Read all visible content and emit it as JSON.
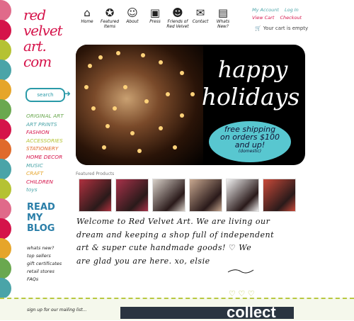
{
  "logo": {
    "lines": [
      "red",
      "velvet",
      "art.",
      "com"
    ]
  },
  "search": {
    "label": "search"
  },
  "categories": [
    {
      "label": "ORIGINAL ART",
      "color": "#6aa84f"
    },
    {
      "label": "ART PRINTS",
      "color": "#4aa4a8"
    },
    {
      "label": "FASHION",
      "color": "#d5134a"
    },
    {
      "label": "ACCESSORIES",
      "color": "#b5c233"
    },
    {
      "label": "STATIONERY",
      "color": "#e06a2a"
    },
    {
      "label": "HOME DECOR",
      "color": "#d5134a"
    },
    {
      "label": "MUSIC",
      "color": "#4aa4a8"
    },
    {
      "label": "CRAFT",
      "color": "#e6a52a"
    },
    {
      "label": "CHILDREN",
      "color": "#d5134a"
    },
    {
      "label": "toys",
      "color": "#4aa4a8"
    }
  ],
  "blog": {
    "lines": [
      "READ",
      "MY",
      "BLOG"
    ]
  },
  "side_links": [
    "whats new?",
    "top sellers",
    "gift certificates",
    "retail stores",
    "FAQs"
  ],
  "nav": [
    {
      "label": "Home",
      "icon": "house-icon",
      "glyph": "⌂"
    },
    {
      "label": "Featured Items",
      "icon": "ribbon-icon",
      "glyph": "✪"
    },
    {
      "label": "About",
      "icon": "girl-icon",
      "glyph": "☺"
    },
    {
      "label": "Press",
      "icon": "tv-icon",
      "glyph": "▣"
    },
    {
      "label": "Friends of Red Velvet",
      "icon": "friend-icon",
      "glyph": "☻"
    },
    {
      "label": "Contact",
      "icon": "envelope-icon",
      "glyph": "✉"
    },
    {
      "label": "Whats New?",
      "icon": "camera-icon",
      "glyph": "▤"
    }
  ],
  "account": {
    "row1": [
      "My Account",
      "Log In"
    ],
    "row2": [
      "View Cart",
      "Checkout"
    ],
    "cart_status": "Your cart is empty"
  },
  "banner": {
    "line1": "happy",
    "line2": "holidays",
    "ship1": "free shipping",
    "ship2": "on orders $100",
    "ship3": "and up!",
    "ship4": "(domestic)"
  },
  "featured_label": "Featured Products",
  "products": [
    {
      "color": "#b0313f"
    },
    {
      "color": "#a8324a"
    },
    {
      "color": "#d8d0c8"
    },
    {
      "color": "#c8a890"
    },
    {
      "color": "#f0f0f0"
    },
    {
      "color": "#c94a3a"
    }
  ],
  "welcome": [
    "Welcome to Red Velvet Art. We are living our",
    "dream and keeping a shop full of independent",
    "art & super cute handmade goods! ♡ We",
    "are glad you are here. xo, elsie"
  ],
  "mailing_label": "sign up for our mailing list...",
  "collect_label": "collect",
  "scallop_colors": [
    "#e06a8a",
    "#d5134a",
    "#b5c233",
    "#4aa4a8",
    "#e6a52a",
    "#6aa84f",
    "#d5134a",
    "#e06a2a",
    "#4aa4a8",
    "#b5c233",
    "#e06a8a",
    "#d5134a",
    "#e6a52a",
    "#6aa84f",
    "#4aa4a8",
    "#d5134a"
  ]
}
